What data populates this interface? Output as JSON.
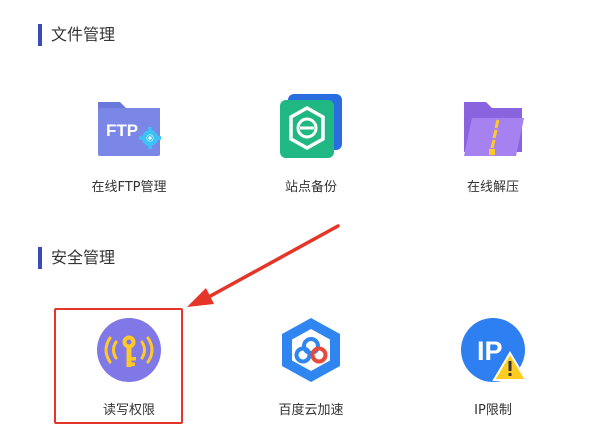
{
  "sections": [
    {
      "title": "文件管理",
      "tiles": [
        {
          "label": "在线FTP管理",
          "icon": "ftp-folder-icon",
          "badge_text": "FTP"
        },
        {
          "label": "站点备份",
          "icon": "site-backup-icon"
        },
        {
          "label": "在线解压",
          "icon": "zip-folder-icon"
        }
      ]
    },
    {
      "title": "安全管理",
      "tiles": [
        {
          "label": "读写权限",
          "icon": "key-signal-icon"
        },
        {
          "label": "百度云加速",
          "icon": "baidu-cloud-icon"
        },
        {
          "label": "IP限制",
          "icon": "ip-warning-icon",
          "badge_text": "IP"
        }
      ]
    }
  ],
  "colors": {
    "section_accent": "#3a4db7",
    "ftp_folder": "#7a87e6",
    "backup_green": "#1fb882",
    "backup_blue": "#2a6de0",
    "zip_purple": "#9a74e8",
    "key_circle": "#7f78e6",
    "key_yellow": "#ffc926",
    "baidu_blue": "#2f86f0",
    "ip_blue": "#2d7ff2",
    "warning_yellow": "#ffcc1f",
    "annotation_red": "#e53528"
  }
}
